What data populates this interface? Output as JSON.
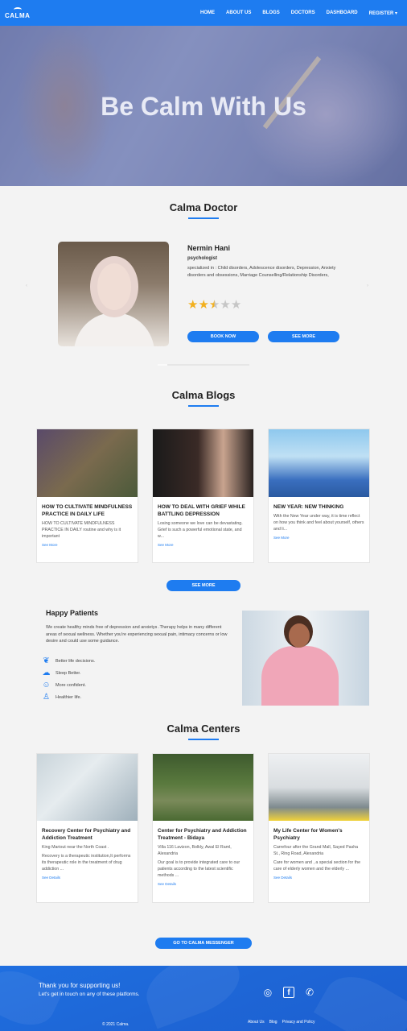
{
  "navbar": {
    "logo_text": "CALMA",
    "items": [
      "HOME",
      "ABOUT US",
      "BLOGS",
      "DOCTORS",
      "DASHBOARD",
      "REGISTER ▾"
    ]
  },
  "hero": {
    "title": "Be Calm With Us"
  },
  "doctor_section": {
    "title": "Calma Doctor",
    "doctor": {
      "name": "Nermin Hani",
      "role": "psychologist",
      "specialization": "specialized in : Child disorders, Adolescence disorders, Depression, Anxiety disorders and obsessions, Marriage Counselling/Relationship Disorders,",
      "rating": 2.5,
      "rating_max": 5
    },
    "book_now": "BOOK NOW",
    "see_more": "SEE MORE",
    "prev_arrow": "‹",
    "next_arrow": "›"
  },
  "blogs_section": {
    "title": "Calma Blogs",
    "posts": [
      {
        "title": "HOW TO CULTIVATE MINDFULNESS PRACTICE IN DAILY LIFE",
        "excerpt": "HOW TO CULTIVATE MINDFULNESS PRACTICE IN DAILY routine and why is it important",
        "link": "See More"
      },
      {
        "title": "HOW TO DEAL WITH GRIEF WHILE BATTLING DEPRESSION",
        "excerpt": "Losing someone we love can be devastating. Grief is such a powerful emotional state, and w...",
        "link": "See More"
      },
      {
        "title": "NEW YEAR: NEW THINKING",
        "excerpt": "With the New Year under way, it is time reflect on how you think and feel about yourself, others and li...",
        "link": "See More"
      }
    ],
    "see_more": "SEE MORE"
  },
  "happy_patients": {
    "title": "Happy Patients",
    "text": "We create healthy minds free of depression and anxietys .Therapy helps in many different areas of sexual wellness. Whether you're experiencing sexual pain, intimacy concerns or low desire and could use some guidance.",
    "benefits": [
      "Better life decisions.",
      "Sleep Better.",
      "More confident.",
      "Healthier life."
    ]
  },
  "centers_section": {
    "title": "Calma Centers",
    "centers": [
      {
        "name": "Recovery Center for Psychiatry and Addiction Treatment",
        "address": "King Mariout near the North Coast .",
        "desc": "Recovery is a therapeutic institution,It performs its therapeutic role in the treatment of drug addiction ...",
        "link": "See Details"
      },
      {
        "name": "Center for Psychiatry and Addiction Treatment - Bidaya",
        "address": "Villa 116 Lavizon, Bolkly, Awal El Raml, Alexandria",
        "desc": "Our goal is to provide integrated care to our patients according to the latest scientific methods ...",
        "link": "See Details"
      },
      {
        "name": "My Life Center for Women's Psychiatry",
        "address": "Carrefour after the Grand Mall, Sayed Pasha St., Ring Road, Alexandria",
        "desc": "Care for women and , a special section for the care of elderly women and the elderly ...",
        "link": "See Details"
      }
    ],
    "messenger_button": "GO TO CALMA MESSENGER"
  },
  "footer": {
    "thanks": "Thank you for supporting us!",
    "touch": "Let's get in touch on any of these platforms.",
    "copyright": "© 2021 Calma.",
    "links": [
      "About Us",
      "Blog",
      "Privacy and Policy"
    ],
    "socials": [
      "instagram-icon",
      "facebook-icon",
      "whatsapp-icon"
    ]
  },
  "colors": {
    "primary": "#1e7cf0",
    "star": "#f2b01e",
    "background": "#f3f3f3"
  }
}
